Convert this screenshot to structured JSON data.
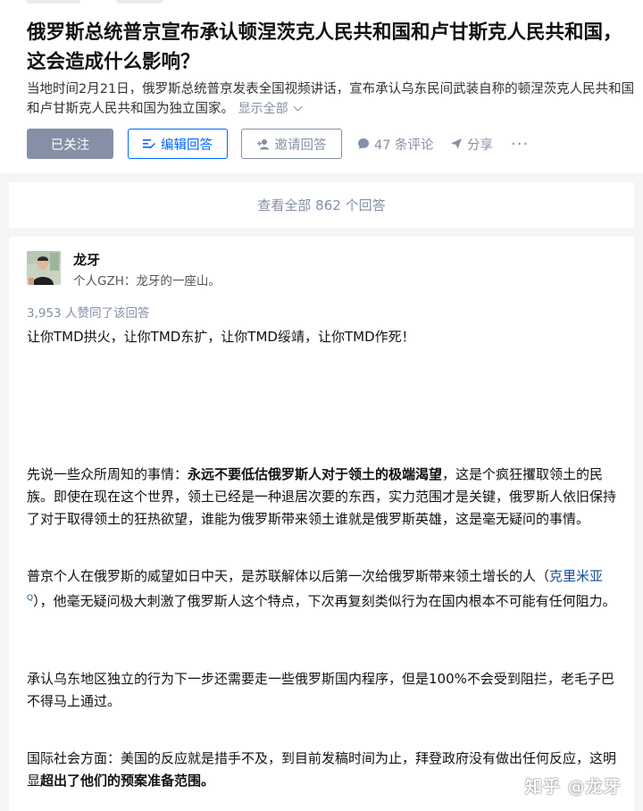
{
  "question": {
    "title": "俄罗斯总统普京宣布承认顿涅茨克人民共和国和卢甘斯克人民共和国，这会造成什么影响？",
    "detail": "当地时间2月21日，俄罗斯总统普京发表全国视频讲话，宣布承认乌东民间武装自称的顿涅茨克人民共和国和卢甘斯克人民共和国为独立国家。",
    "show_all_label": "显示全部"
  },
  "actions": {
    "followed_label": "已关注",
    "edit_answer_label": "编辑回答",
    "invite_answer_label": "邀请回答",
    "comments_label": "47 条评论",
    "share_label": "分享",
    "more_label": "···"
  },
  "view_all_label": "查看全部 862 个回答",
  "answer": {
    "author_name": "龙牙",
    "author_headline": "个人GZH：龙牙的一座山。",
    "vote_info": "3,953 人赞同了该回答",
    "paragraphs": {
      "p1": "让你TMD拱火，让你TMD东扩，让你TMD绥靖，让你TMD作死！",
      "p2_a": "先说一些众所周知的事情：",
      "p2_bold": "永远不要低估俄罗斯人对于领土的极端渴望",
      "p2_b": "，这是个疯狂攫取领土的民族。即使在现在这个世界，领土已经是一种退居次要的东西，实力范围才是关键，俄罗斯人依旧保持了对于取得领土的狂热欲望，谁能为俄罗斯带来领土谁就是俄罗斯英雄，这是毫无疑问的事情。",
      "p3_a": "普京个人在俄罗斯的威望如日中天，是苏联解体以后第一次给俄罗斯带来领土增长的人（",
      "p3_link": "克里米亚",
      "p3_b": "），他毫无疑问极大刺激了俄罗斯人这个特点，下次再复刻类似行为在国内根本不可能有任何阻力。",
      "p4": "承认乌东地区独立的行为下一步还需要走一些俄罗斯国内程序，但是100%不会受到阻拦，老毛子巴不得马上通过。",
      "p5_a": "国际社会方面：美国的反应就是措手不及，到目前发稿时间为止，拜登政府没有做出任何反应，这明显",
      "p5_bold": "超出了他们的预案准备范围。"
    }
  },
  "watermark": "知乎 @龙牙",
  "colors": {
    "brand_blue": "#0066ff",
    "muted_gray": "#8590a6",
    "link_blue": "#175199"
  }
}
